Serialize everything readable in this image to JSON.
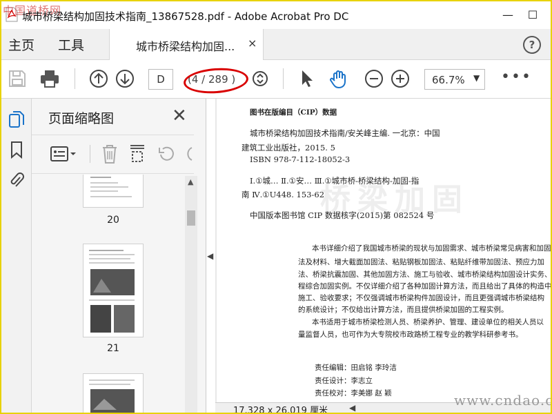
{
  "window": {
    "watermark_top": "中国道桥网",
    "title": "城市桥梁结构加固技术指南_13867528.pdf - Adobe Acrobat Pro DC",
    "minimize": "—",
    "maximize": "☐"
  },
  "menu": {
    "home": "主页",
    "tools": "工具",
    "tab_label": "城市桥梁结构加固...",
    "tab_close": "×",
    "help": "?"
  },
  "toolbar": {
    "page_input": "D",
    "page_count": "(4 / 289 )",
    "zoom": "66.7%",
    "more": "•••"
  },
  "thumbnails": {
    "title": "页面缩略图",
    "close": "✕",
    "pages": [
      {
        "label": "20"
      },
      {
        "label": "21"
      }
    ]
  },
  "document": {
    "ghost_text": "桥梁加固",
    "lines": [
      "图书在版编目（CIP）数据",
      "城市桥梁结构加固技术指南/安关峰主编. 一北京：中国",
      "建筑工业出版社，2015. 5",
      "ISBN 978-7-112-18052-3",
      "Ⅰ.①城…  Ⅱ.①安…  Ⅲ.①城市桥-桥梁结构-加固-指",
      "南  Ⅳ.①U448. 153-62",
      "中国版本图书馆 CIP 数据核字(2015)第 082524 号",
      "本书详细介绍了我国城市桥梁的现状与加固需求、城市桥梁常见病害和加固",
      "法及材料、增大截面加固法、粘贴钢板加固法、粘贴纤维带加固法、预应力加",
      "法、桥梁抗震加固、其他加固方法、施工与验收、城市桥梁结构加固设计实务、",
      "程综合加固实例。不仅详细介绍了各种加固计算方法，而且给出了具体的构造中",
      "施工、验收要求；不仅强调城市桥梁构件加固设计，而且更强调城市桥梁结构",
      "的系统设计；不仅给出计算方法，而且提供桥梁加固的工程实例。",
      "本书适用于城市桥梁检测人员、桥梁养护、管理、建设单位的相关人员以",
      "量监督人员，也可作为大专院校市政路桥工程专业的教学科研参考书。",
      "责任编辑：田启铭    李玲洁",
      "责任设计：李志立",
      "责任校对：李美娜    赵    颖"
    ]
  },
  "status": {
    "page_size": "17.328 x 26.019 厘米",
    "watermark_bottom": "www.cndao.com"
  },
  "colors": {
    "accent_blue": "#1a73c9",
    "highlight_red": "#d90000",
    "frame_yellow": "#e8d200"
  }
}
